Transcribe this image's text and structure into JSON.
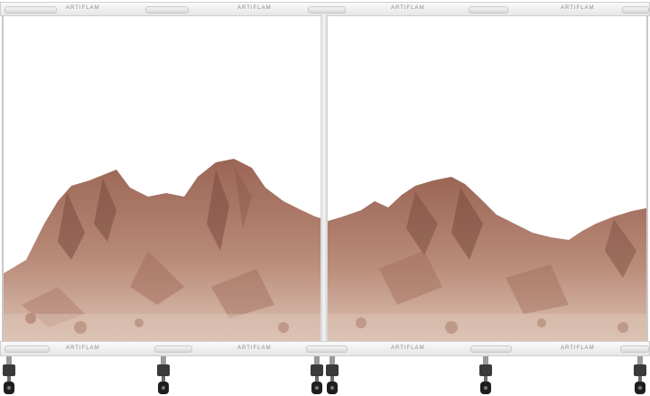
{
  "brand_text": "ARTIFLAM",
  "colors": {
    "mountain_dark": "#8a5a4e",
    "mountain_mid": "#b07a6a",
    "mountain_light": "#d6b6a5",
    "frame": "#c8c8c8"
  }
}
